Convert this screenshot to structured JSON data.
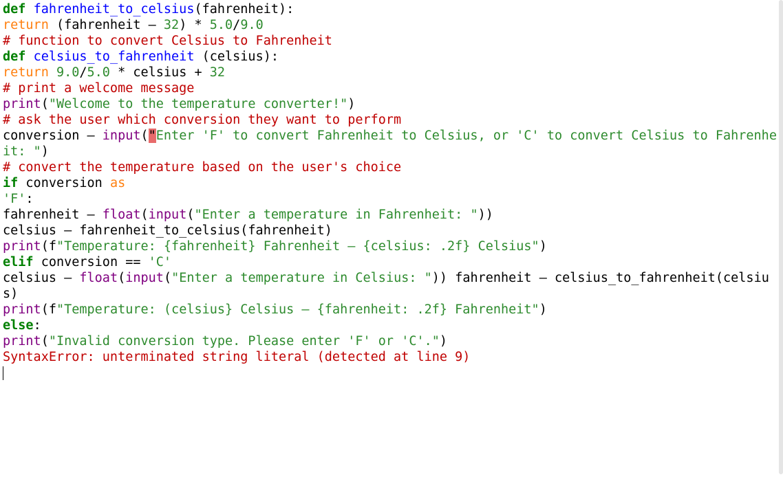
{
  "code": {
    "l1_def": "def",
    "l1_fn": "fahrenheit_to_celsius",
    "l1_rest": "(fahrenheit):",
    "l2_ret": "return",
    "l2_rest_a": " (fahrenheit – ",
    "l2_32": "32",
    "l2_rest_b": ") * ",
    "l2_50": "5.0",
    "l2_slash": "/",
    "l2_90": "9.0",
    "l3": "# function to convert Celsius to Fahrenheit",
    "l4_def": "def",
    "l4_fn": "celsius_to_fahrenheit",
    "l4_rest": " (celsius):",
    "l5_ret": "return",
    "l5_a": " ",
    "l5_90": "9.0",
    "l5_s1": "/",
    "l5_50": "5.0",
    "l5_b": " * celsius + ",
    "l5_32": "32",
    "l6": "# print a welcome message",
    "l7_print": "print",
    "l7_p1": "(",
    "l7_str": "\"Welcome to the temperature converter!\"",
    "l7_p2": ")",
    "l8": "# ask the user which conversion they want to perform",
    "l9_a": "conversion – ",
    "l9_input": "input",
    "l9_p1": "(",
    "l9_hl": "\"",
    "l9_str1": "Enter 'F' to convert Fahrenheit to Celsius, or ",
    "l9_str2": "'C' to convert Celsius to Fahrenheit: \"",
    "l9_p2": ")",
    "l10": "# convert the temperature based on the user's choice",
    "l11_if": "if",
    "l11_mid": " conversion ",
    "l11_as": "as",
    "l12": "'F'",
    "l12_colon": ":",
    "l13_a": "fahrenheit – ",
    "l13_float": "float",
    "l13_p1": "(",
    "l13_input": "input",
    "l13_p2": "(",
    "l13_str": "\"Enter a temperature in Fahrenheit: ",
    "l13_str2": "\"",
    "l13_p3": "))",
    "l14": "celsius – fahrenheit_to_celsius(fahrenheit)",
    "l15_print": "print",
    "l15_a": "(f",
    "l15_str": "\"Temperature: {fahrenheit} Fahrenheit – {celsius: .2f} ",
    "l15_str2": "Celsius\"",
    "l15_p": ")",
    "l16_elif": "elif",
    "l16_a": " conversion == ",
    "l16_c": "'C'",
    "l17_a": "celsius – ",
    "l17_float": "float",
    "l17_p1": "(",
    "l17_input": "input",
    "l17_p2": "(",
    "l17_str": "\"Enter a temperature in Celsius: \"",
    "l17_p3": ")) fahrenheit – celsius_to_fahrenheit(celsius)",
    "l18_print": "print",
    "l18_a": "(f",
    "l18_str": "\"Temperature: (celsius} Celsius – {fahrenheit: .2f} ",
    "l18_str2": "Fahrenheit\"",
    "l18_p": ")",
    "l19_else": "else",
    "l19_colon": ":",
    "l20_print": "print",
    "l20_p1": "(",
    "l20_str": "\"Invalid conversion type. Please enter 'F' or 'C'.\"",
    "l20_p2": ")",
    "error": "SyntaxError: unterminated string literal (detected at line 9)"
  }
}
